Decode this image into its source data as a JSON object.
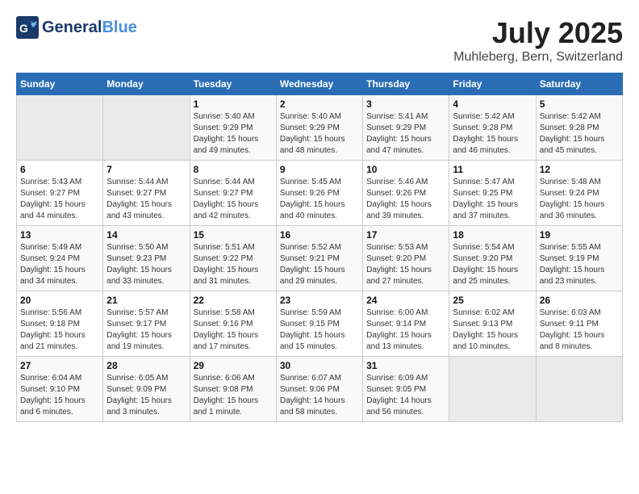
{
  "header": {
    "logo_general": "General",
    "logo_blue": "Blue",
    "month_title": "July 2025",
    "location": "Muhleberg, Bern, Switzerland"
  },
  "weekdays": [
    "Sunday",
    "Monday",
    "Tuesday",
    "Wednesday",
    "Thursday",
    "Friday",
    "Saturday"
  ],
  "weeks": [
    [
      {
        "day": "",
        "sunrise": "",
        "sunset": "",
        "daylight": ""
      },
      {
        "day": "",
        "sunrise": "",
        "sunset": "",
        "daylight": ""
      },
      {
        "day": "1",
        "sunrise": "Sunrise: 5:40 AM",
        "sunset": "Sunset: 9:29 PM",
        "daylight": "Daylight: 15 hours and 49 minutes."
      },
      {
        "day": "2",
        "sunrise": "Sunrise: 5:40 AM",
        "sunset": "Sunset: 9:29 PM",
        "daylight": "Daylight: 15 hours and 48 minutes."
      },
      {
        "day": "3",
        "sunrise": "Sunrise: 5:41 AM",
        "sunset": "Sunset: 9:29 PM",
        "daylight": "Daylight: 15 hours and 47 minutes."
      },
      {
        "day": "4",
        "sunrise": "Sunrise: 5:42 AM",
        "sunset": "Sunset: 9:28 PM",
        "daylight": "Daylight: 15 hours and 46 minutes."
      },
      {
        "day": "5",
        "sunrise": "Sunrise: 5:42 AM",
        "sunset": "Sunset: 9:28 PM",
        "daylight": "Daylight: 15 hours and 45 minutes."
      }
    ],
    [
      {
        "day": "6",
        "sunrise": "Sunrise: 5:43 AM",
        "sunset": "Sunset: 9:27 PM",
        "daylight": "Daylight: 15 hours and 44 minutes."
      },
      {
        "day": "7",
        "sunrise": "Sunrise: 5:44 AM",
        "sunset": "Sunset: 9:27 PM",
        "daylight": "Daylight: 15 hours and 43 minutes."
      },
      {
        "day": "8",
        "sunrise": "Sunrise: 5:44 AM",
        "sunset": "Sunset: 9:27 PM",
        "daylight": "Daylight: 15 hours and 42 minutes."
      },
      {
        "day": "9",
        "sunrise": "Sunrise: 5:45 AM",
        "sunset": "Sunset: 9:26 PM",
        "daylight": "Daylight: 15 hours and 40 minutes."
      },
      {
        "day": "10",
        "sunrise": "Sunrise: 5:46 AM",
        "sunset": "Sunset: 9:26 PM",
        "daylight": "Daylight: 15 hours and 39 minutes."
      },
      {
        "day": "11",
        "sunrise": "Sunrise: 5:47 AM",
        "sunset": "Sunset: 9:25 PM",
        "daylight": "Daylight: 15 hours and 37 minutes."
      },
      {
        "day": "12",
        "sunrise": "Sunrise: 5:48 AM",
        "sunset": "Sunset: 9:24 PM",
        "daylight": "Daylight: 15 hours and 36 minutes."
      }
    ],
    [
      {
        "day": "13",
        "sunrise": "Sunrise: 5:49 AM",
        "sunset": "Sunset: 9:24 PM",
        "daylight": "Daylight: 15 hours and 34 minutes."
      },
      {
        "day": "14",
        "sunrise": "Sunrise: 5:50 AM",
        "sunset": "Sunset: 9:23 PM",
        "daylight": "Daylight: 15 hours and 33 minutes."
      },
      {
        "day": "15",
        "sunrise": "Sunrise: 5:51 AM",
        "sunset": "Sunset: 9:22 PM",
        "daylight": "Daylight: 15 hours and 31 minutes."
      },
      {
        "day": "16",
        "sunrise": "Sunrise: 5:52 AM",
        "sunset": "Sunset: 9:21 PM",
        "daylight": "Daylight: 15 hours and 29 minutes."
      },
      {
        "day": "17",
        "sunrise": "Sunrise: 5:53 AM",
        "sunset": "Sunset: 9:20 PM",
        "daylight": "Daylight: 15 hours and 27 minutes."
      },
      {
        "day": "18",
        "sunrise": "Sunrise: 5:54 AM",
        "sunset": "Sunset: 9:20 PM",
        "daylight": "Daylight: 15 hours and 25 minutes."
      },
      {
        "day": "19",
        "sunrise": "Sunrise: 5:55 AM",
        "sunset": "Sunset: 9:19 PM",
        "daylight": "Daylight: 15 hours and 23 minutes."
      }
    ],
    [
      {
        "day": "20",
        "sunrise": "Sunrise: 5:56 AM",
        "sunset": "Sunset: 9:18 PM",
        "daylight": "Daylight: 15 hours and 21 minutes."
      },
      {
        "day": "21",
        "sunrise": "Sunrise: 5:57 AM",
        "sunset": "Sunset: 9:17 PM",
        "daylight": "Daylight: 15 hours and 19 minutes."
      },
      {
        "day": "22",
        "sunrise": "Sunrise: 5:58 AM",
        "sunset": "Sunset: 9:16 PM",
        "daylight": "Daylight: 15 hours and 17 minutes."
      },
      {
        "day": "23",
        "sunrise": "Sunrise: 5:59 AM",
        "sunset": "Sunset: 9:15 PM",
        "daylight": "Daylight: 15 hours and 15 minutes."
      },
      {
        "day": "24",
        "sunrise": "Sunrise: 6:00 AM",
        "sunset": "Sunset: 9:14 PM",
        "daylight": "Daylight: 15 hours and 13 minutes."
      },
      {
        "day": "25",
        "sunrise": "Sunrise: 6:02 AM",
        "sunset": "Sunset: 9:13 PM",
        "daylight": "Daylight: 15 hours and 10 minutes."
      },
      {
        "day": "26",
        "sunrise": "Sunrise: 6:03 AM",
        "sunset": "Sunset: 9:11 PM",
        "daylight": "Daylight: 15 hours and 8 minutes."
      }
    ],
    [
      {
        "day": "27",
        "sunrise": "Sunrise: 6:04 AM",
        "sunset": "Sunset: 9:10 PM",
        "daylight": "Daylight: 15 hours and 6 minutes."
      },
      {
        "day": "28",
        "sunrise": "Sunrise: 6:05 AM",
        "sunset": "Sunset: 9:09 PM",
        "daylight": "Daylight: 15 hours and 3 minutes."
      },
      {
        "day": "29",
        "sunrise": "Sunrise: 6:06 AM",
        "sunset": "Sunset: 9:08 PM",
        "daylight": "Daylight: 15 hours and 1 minute."
      },
      {
        "day": "30",
        "sunrise": "Sunrise: 6:07 AM",
        "sunset": "Sunset: 9:06 PM",
        "daylight": "Daylight: 14 hours and 58 minutes."
      },
      {
        "day": "31",
        "sunrise": "Sunrise: 6:09 AM",
        "sunset": "Sunset: 9:05 PM",
        "daylight": "Daylight: 14 hours and 56 minutes."
      },
      {
        "day": "",
        "sunrise": "",
        "sunset": "",
        "daylight": ""
      },
      {
        "day": "",
        "sunrise": "",
        "sunset": "",
        "daylight": ""
      }
    ]
  ]
}
